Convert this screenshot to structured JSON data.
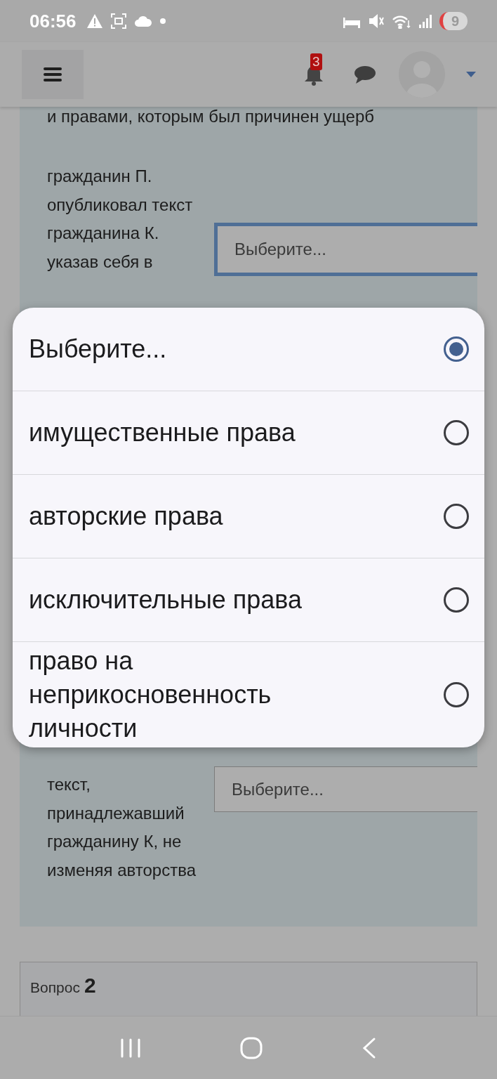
{
  "status_bar": {
    "time": "06:56",
    "battery": "9"
  },
  "header": {
    "notification_count": "3"
  },
  "question_1": {
    "intro_line": "и правами, которым был причинен ущерб",
    "items": [
      {
        "text": "гражданин П. опубликовал текст гражданина К. указав себя в",
        "select_value": "Выберите...",
        "focused": true
      },
      {
        "text": "текст, принадлежавший гражданину К, не изменяя авторства",
        "select_value": "Выберите...",
        "focused": false
      }
    ]
  },
  "dropdown": {
    "options": [
      {
        "label": "Выберите...",
        "selected": true
      },
      {
        "label": "имущественные права",
        "selected": false
      },
      {
        "label": "авторские права",
        "selected": false
      },
      {
        "label": "исключительные права",
        "selected": false
      },
      {
        "label": "право на неприкосновенность личности",
        "selected": false
      }
    ]
  },
  "question_2": {
    "label": "Вопрос",
    "number": "2"
  }
}
